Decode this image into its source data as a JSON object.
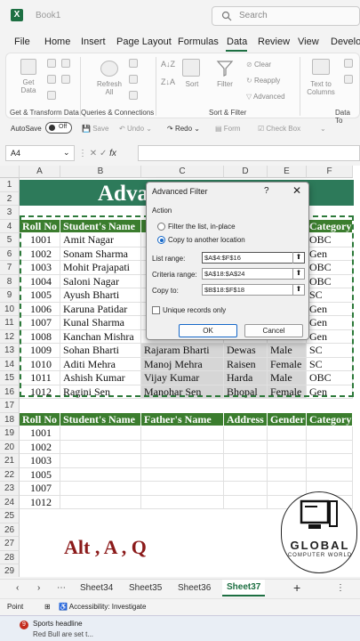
{
  "titlebar": {
    "doc_title": "Book1",
    "search_placeholder": "Search",
    "app_icon": "X"
  },
  "menu": [
    "File",
    "Home",
    "Insert",
    "Page Layout",
    "Formulas",
    "Data",
    "Review",
    "View",
    "Develop"
  ],
  "ribbon": {
    "get_data": "Get\nData",
    "refresh_all": "Refresh\nAll",
    "sort": "Sort",
    "filter": "Filter",
    "clear": "Clear",
    "reapply": "Reapply",
    "advanced": "Advanced",
    "text_to_columns": "Text to\nColumns",
    "groups": [
      "Get & Transform Data",
      "Queries & Connections",
      "Sort & Filter",
      "Data To"
    ]
  },
  "qat": {
    "autosave": "AutoSave",
    "toggle": "Off",
    "save": "Save",
    "undo": "Undo",
    "redo": "Redo",
    "form": "Form",
    "check_box": "Check Box"
  },
  "formula_bar": {
    "name_box": "A4",
    "fx": "fx"
  },
  "columns": [
    "A",
    "B",
    "C",
    "D",
    "E",
    "F"
  ],
  "rows": [
    "1",
    "2",
    "3",
    "4",
    "5",
    "6",
    "7",
    "8",
    "9",
    "10",
    "11",
    "12",
    "13",
    "14",
    "15",
    "16",
    "17",
    "18",
    "19",
    "20",
    "21",
    "22",
    "23",
    "24",
    "25",
    "26",
    "27",
    "28",
    "29"
  ],
  "title_text": "Adva",
  "table1": {
    "headers": [
      "Roll No",
      "Student's Name",
      "",
      "",
      "",
      "Category"
    ],
    "rows": [
      [
        "1001",
        "Amit Nagar",
        "",
        "",
        "",
        "OBC"
      ],
      [
        "1002",
        "Sonam Sharma",
        "",
        "",
        "",
        "Gen"
      ],
      [
        "1003",
        "Mohit Prajapati",
        "",
        "",
        "",
        "OBC"
      ],
      [
        "1004",
        "Saloni Nagar",
        "",
        "",
        "",
        "OBC"
      ],
      [
        "1005",
        "Ayush Bharti",
        "",
        "",
        "",
        "SC"
      ],
      [
        "1006",
        "Karuna Patidar",
        "",
        "",
        "",
        "Gen"
      ],
      [
        "1007",
        "Kunal Sharma",
        "",
        "",
        "",
        "Gen"
      ],
      [
        "1008",
        "Kanchan Mishra",
        "",
        "",
        "",
        "Gen"
      ],
      [
        "1009",
        "Sohan Bharti",
        "Rajaram Bharti",
        "Dewas",
        "Male",
        "SC"
      ],
      [
        "1010",
        "Aditi Mehra",
        "Manoj Mehra",
        "Raisen",
        "Female",
        "SC"
      ],
      [
        "1011",
        "Ashish Kumar",
        "Vijay Kumar",
        "Harda",
        "Male",
        "OBC"
      ],
      [
        "1012",
        "Ragini Sen",
        "Manohar Sen",
        "Bhopal",
        "Female",
        "Gen"
      ]
    ]
  },
  "table2": {
    "headers": [
      "Roll No",
      "Student's Name",
      "Father's Name",
      "Address",
      "Gender",
      "Category"
    ],
    "rows": [
      [
        "1001"
      ],
      [
        "1002"
      ],
      [
        "1003"
      ],
      [
        "1005"
      ],
      [
        "1007"
      ],
      [
        "1012"
      ]
    ]
  },
  "shortcut_text": "Alt , A , Q",
  "logo": {
    "line1": "GLOBAL",
    "line2": "COMPUTER WORLD"
  },
  "dialog": {
    "title": "Advanced Filter",
    "help": "?",
    "close": "✕",
    "action_label": "Action",
    "opt1": "Filter the list, in-place",
    "opt2": "Copy to another location",
    "list_range_label": "List range:",
    "list_range": "$A$4:$F$16",
    "criteria_range_label": "Criteria range:",
    "criteria_range": "$A$18:$A$24",
    "copy_to_label": "Copy to:",
    "copy_to": "$B$18:$F$18",
    "unique_label": "Unique records only",
    "ok": "OK",
    "cancel": "Cancel"
  },
  "sheets": [
    "Sheet34",
    "Sheet35",
    "Sheet36",
    "Sheet37"
  ],
  "active_sheet": "Sheet37",
  "status": {
    "mode": "Point",
    "accessibility": "Accessibility: Investigate"
  },
  "taskbar": {
    "headline": "Sports headline",
    "sub": "Red Bull are set t...",
    "badge": "9"
  },
  "colors": {
    "excel_green": "#1d6f42",
    "header_green": "#3b7d2e",
    "title_band": "#2d7a5a",
    "shortcut": "#8b1a1a"
  }
}
